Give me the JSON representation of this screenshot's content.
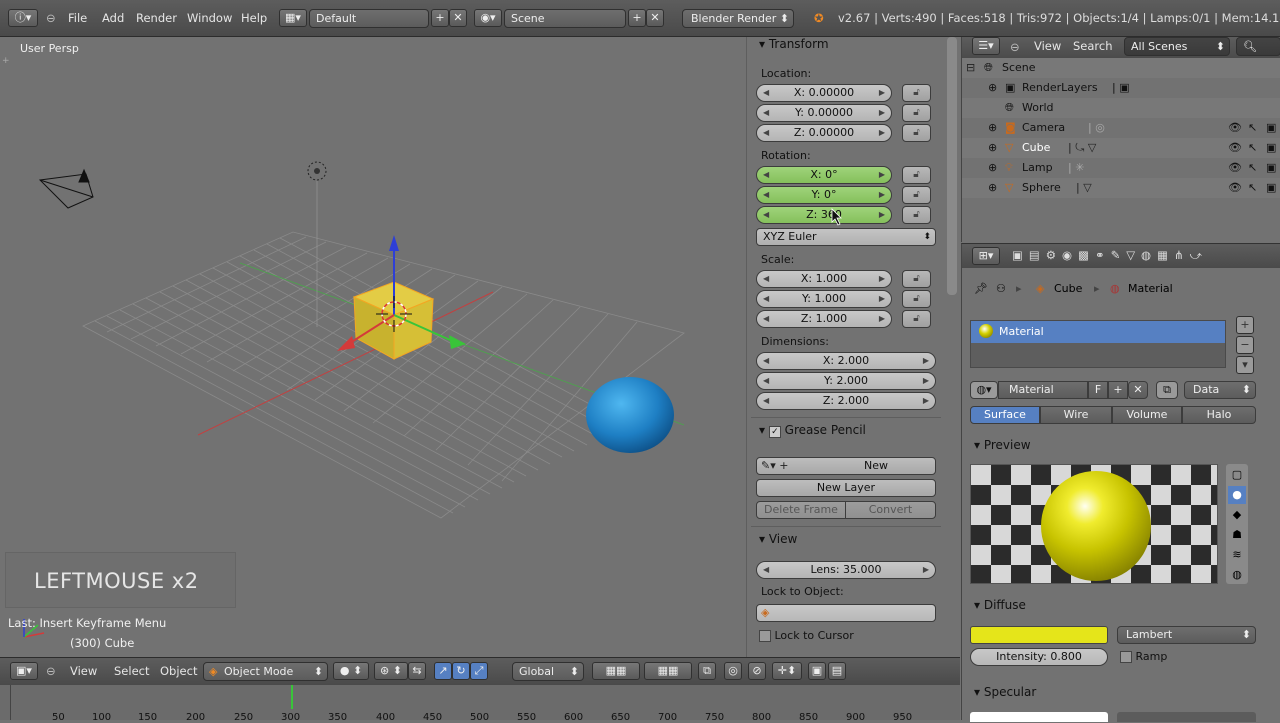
{
  "topbar": {
    "menu": [
      "File",
      "Add",
      "Render",
      "Window",
      "Help"
    ],
    "screen_layout": "Default",
    "scene": "Scene",
    "render_engine": "Blender Render",
    "stats": "v2.67 | Verts:490 | Faces:518 | Tris:972 | Objects:1/4 | Lamps:0/1 | Mem:14.14M (0.59"
  },
  "viewport": {
    "label": "User Persp",
    "keypress": "LEFTMOUSE x2",
    "last_op": "Last: Insert Keyframe Menu",
    "object_info": "(300) Cube"
  },
  "npanel": {
    "transform_title": "Transform",
    "location_label": "Location:",
    "location": [
      "X: 0.00000",
      "Y: 0.00000",
      "Z: 0.00000"
    ],
    "rotation_label": "Rotation:",
    "rotation": [
      "X: 0°",
      "Y: 0°",
      "Z: 360"
    ],
    "rotation_mode": "XYZ Euler",
    "scale_label": "Scale:",
    "scale": [
      "X: 1.000",
      "Y: 1.000",
      "Z: 1.000"
    ],
    "dimensions_label": "Dimensions:",
    "dimensions": [
      "X: 2.000",
      "Y: 2.000",
      "Z: 2.000"
    ],
    "grease_pencil_title": "Grease Pencil",
    "gp_new": "New",
    "gp_new_layer": "New Layer",
    "gp_delete_frame": "Delete Frame",
    "gp_convert": "Convert",
    "view_title": "View",
    "lens": "Lens: 35.000",
    "lock_to_object": "Lock to Object:",
    "lock_to_cursor": "Lock to Cursor"
  },
  "outliner": {
    "view": "View",
    "search": "Search",
    "filter": "All Scenes",
    "items": [
      {
        "label": "Scene"
      },
      {
        "label": "RenderLayers"
      },
      {
        "label": "World"
      },
      {
        "label": "Camera"
      },
      {
        "label": "Cube"
      },
      {
        "label": "Lamp"
      },
      {
        "label": "Sphere"
      }
    ]
  },
  "properties": {
    "breadcrumb": [
      "Cube",
      "Material"
    ],
    "slot": "Material",
    "material_name": "Material",
    "fake_user": "F",
    "link": "Data",
    "tabs": [
      "Surface",
      "Wire",
      "Volume",
      "Halo"
    ],
    "preview_title": "Preview",
    "diffuse_title": "Diffuse",
    "diffuse_shader": "Lambert",
    "intensity": "Intensity: 0.800",
    "ramp": "Ramp",
    "specular_title": "Specular",
    "diffuse_color": "#e5e51a"
  },
  "bottombar": {
    "view": "View",
    "select": "Select",
    "object": "Object",
    "mode": "Object Mode",
    "orientation": "Global"
  },
  "timeline": {
    "ticks": [
      "50",
      "100",
      "150",
      "200",
      "250",
      "300",
      "350",
      "400",
      "450",
      "500",
      "550",
      "600",
      "650",
      "700",
      "750",
      "800",
      "850",
      "900",
      "950"
    ]
  }
}
